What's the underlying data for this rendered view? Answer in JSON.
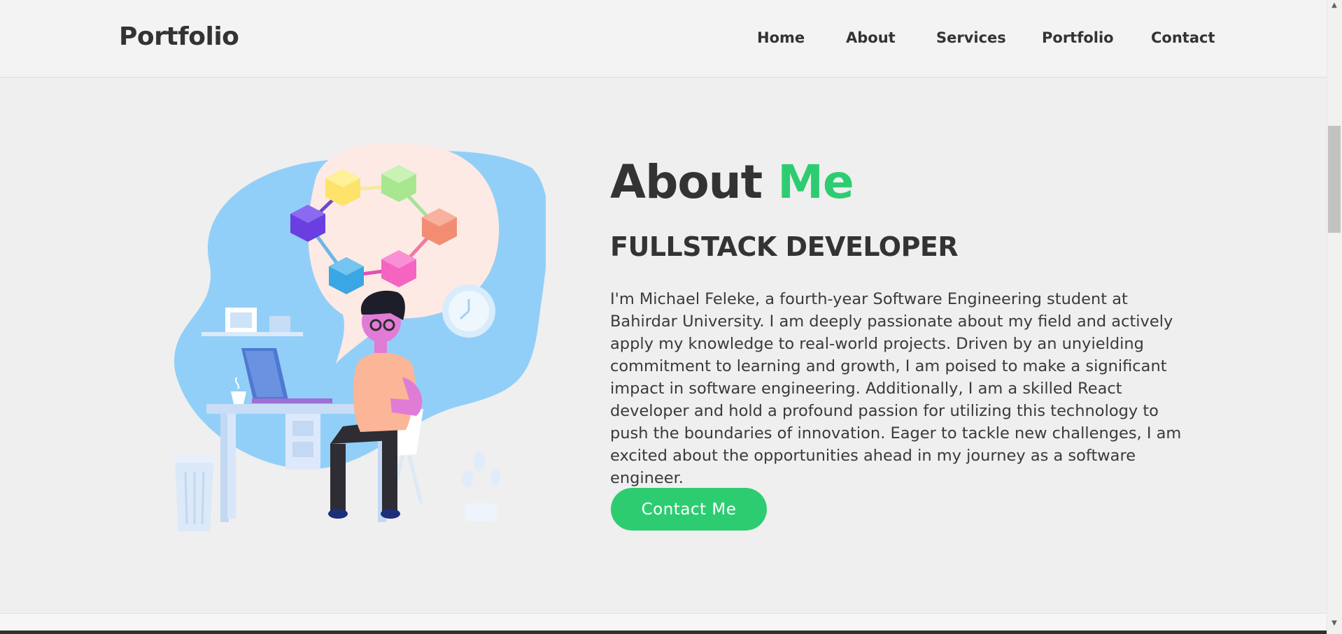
{
  "navbar": {
    "brand": "Portfolio",
    "links": [
      "Home",
      "About",
      "Services",
      "Portfolio",
      "Contact"
    ]
  },
  "about": {
    "title_main": "About ",
    "title_accent": "Me",
    "role": "FULLSTACK DEVELOPER",
    "bio": "I'm Michael Feleke, a fourth-year Software Engineering student at Bahirdar University. I am deeply passionate about my field and actively apply my knowledge to real-world projects. Driven by an unyielding commitment to learning and growth, I am poised to make a significant impact in software engineering. Additionally, I am a skilled React developer and hold a profound passion for utilizing this technology to push the boundaries of innovation. Eager to tackle new challenges, I am excited about the opportunities ahead in my journey as a software engineer.",
    "button_label": "Contact Me"
  },
  "colors": {
    "accent": "#2ecc71",
    "text": "#333333",
    "background": "#efefef",
    "navbar": "#f3f3f3"
  }
}
